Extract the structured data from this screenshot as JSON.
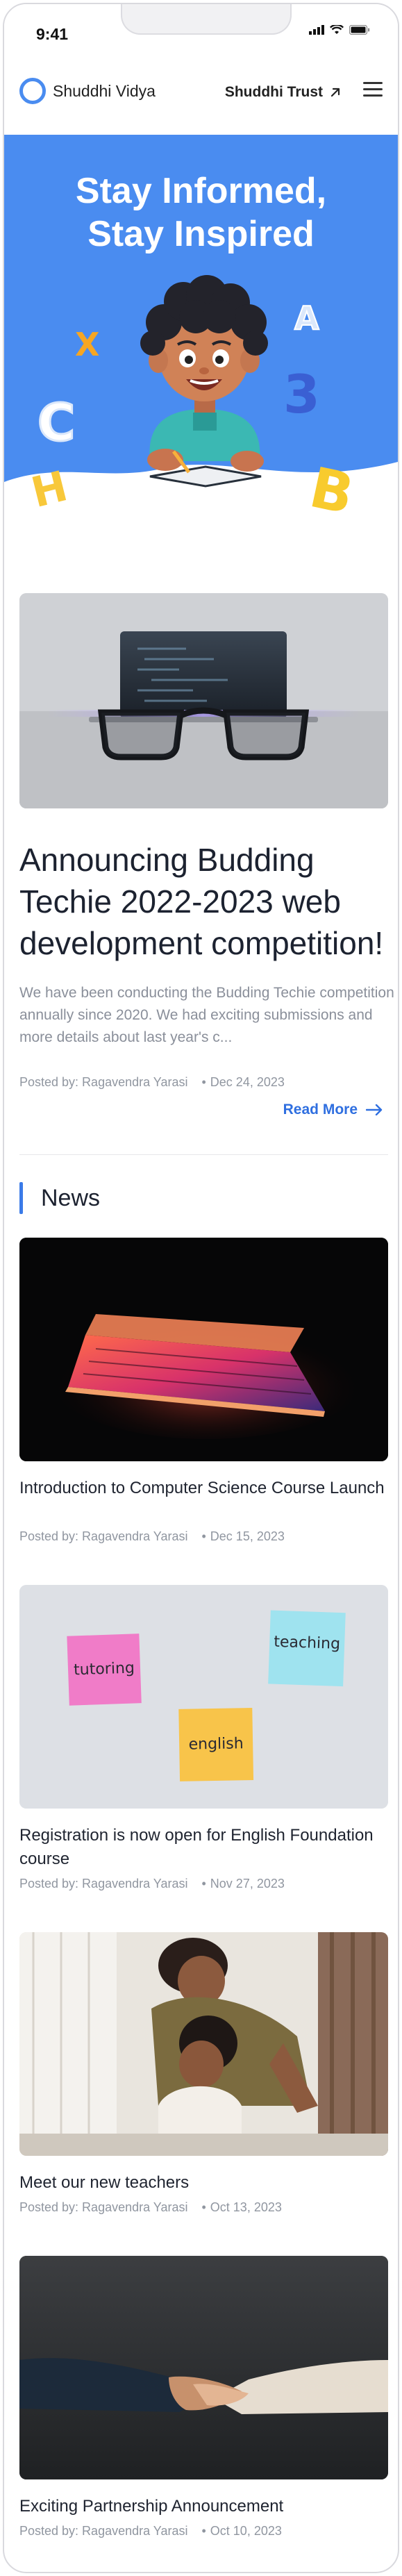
{
  "status_bar": {
    "time": "9:41"
  },
  "header": {
    "brand": "Shuddhi Vidya",
    "trust_link": "Shuddhi Trust"
  },
  "hero": {
    "title_line1": "Stay Informed,",
    "title_line2": "Stay Inspired",
    "letters": [
      "A",
      "X",
      "C",
      "3",
      "H",
      "B"
    ]
  },
  "featured": {
    "title": "Announcing Budding Techie 2022-2023 web development competition!",
    "description": "We have been conducting the Budding Techie competition annually since 2020. We had exciting submissions and more details about last year's c...",
    "author": "Posted by: Ragavendra Yarasi",
    "date": "Dec 24, 2023",
    "read_more": "Read More"
  },
  "news": {
    "heading": "News",
    "items": [
      {
        "title": "Introduction to Computer Science Course Launch",
        "author": "Posted by: Ragavendra Yarasi",
        "date": "Dec 15, 2023"
      },
      {
        "title": "Registration is now open for English Foundation course",
        "author": "Posted by: Ragavendra Yarasi",
        "date": "Nov 27, 2023",
        "notes": [
          "tutoring",
          "teaching",
          "english"
        ]
      },
      {
        "title": "Meet our new teachers",
        "author": "Posted by: Ragavendra Yarasi",
        "date": "Oct 13, 2023"
      },
      {
        "title": "Exciting Partnership Announcement",
        "author": "Posted by: Ragavendra Yarasi",
        "date": "Oct 10, 2023"
      }
    ]
  },
  "colors": {
    "accent": "#4a8cf0",
    "link": "#2f6fe0"
  }
}
